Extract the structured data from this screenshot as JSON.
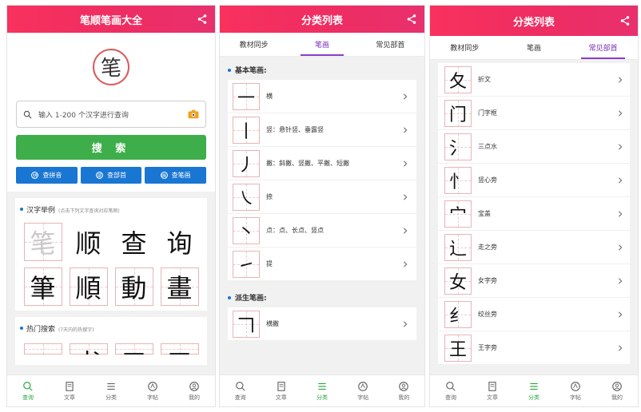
{
  "colors": {
    "header": "#f8315e",
    "accent_green": "#3eae4a",
    "blue": "#1976d2",
    "tab_purple": "#7a2bb8"
  },
  "screen1": {
    "title": "笔顺笔画大全",
    "logo_char": "笔",
    "search_placeholder": "输入 1-200 个汉字进行查询",
    "search_button": "搜 索",
    "small_buttons": [
      {
        "label": "查拼音",
        "icon": "拼"
      },
      {
        "label": "查部首",
        "icon": "部"
      },
      {
        "label": "查笔画",
        "icon": "画"
      }
    ],
    "examples": {
      "title": "汉字举例",
      "subtitle": "(点击下列文字查询对应笔顺)"
    },
    "chars": [
      "笔",
      "顺",
      "查",
      "询",
      "筆",
      "順",
      "動",
      "畫"
    ],
    "hot": {
      "title": "热门搜索",
      "subtitle": "(7天内的热搜字)"
    },
    "hot_chars": [
      "",
      "书",
      "三",
      "三"
    ]
  },
  "screen2": {
    "title": "分类列表",
    "tabs": [
      "教材同步",
      "笔画",
      "常见部首"
    ],
    "active_tab": 1,
    "basic_title": "基本笔画:",
    "basic_strokes": [
      {
        "glyph": "一",
        "label": "横"
      },
      {
        "glyph": "丨",
        "label": "竖：悬针竖、垂露竖"
      },
      {
        "glyph": "丿",
        "label": "撇：斜撇、竖撇、平撇、短撇"
      },
      {
        "glyph": "㇏",
        "label": "捺"
      },
      {
        "glyph": "丶",
        "label": "点：点、长点、竖点"
      },
      {
        "glyph": "㇀",
        "label": "提"
      }
    ],
    "derived_title": "派生笔画:",
    "derived_strokes": [
      {
        "glyph": "𠃍",
        "label": "横撇"
      }
    ]
  },
  "screen3": {
    "title": "分类列表",
    "tabs": [
      "教材同步",
      "笔画",
      "常见部首"
    ],
    "active_tab": 2,
    "radicals": [
      {
        "glyph": "夂",
        "label": "折文"
      },
      {
        "glyph": "门",
        "label": "门字框"
      },
      {
        "glyph": "氵",
        "label": "三点水"
      },
      {
        "glyph": "忄",
        "label": "竖心旁"
      },
      {
        "glyph": "宀",
        "label": "宝盖"
      },
      {
        "glyph": "辶",
        "label": "走之旁"
      },
      {
        "glyph": "女",
        "label": "女字旁"
      },
      {
        "glyph": "纟",
        "label": "绞丝旁"
      },
      {
        "glyph": "王",
        "label": "王字旁"
      }
    ]
  },
  "bottom_nav": [
    "查询",
    "文章",
    "分类",
    "字帖",
    "我的"
  ]
}
